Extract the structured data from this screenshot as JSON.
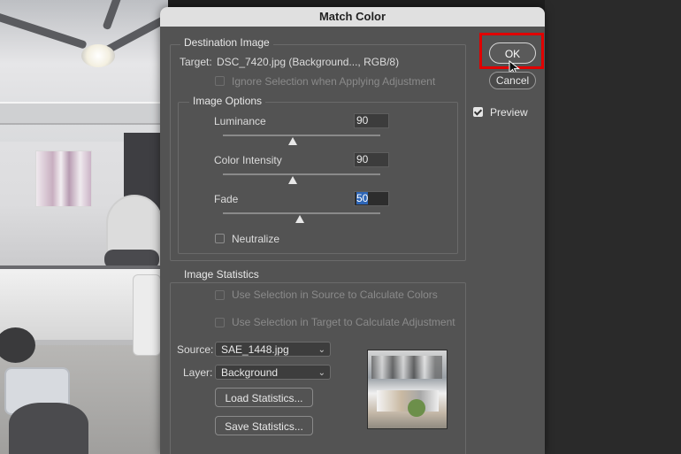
{
  "dialog": {
    "title": "Match Color",
    "ok_label": "OK",
    "cancel_label": "Cancel",
    "preview_label": "Preview",
    "preview_checked": true
  },
  "destination": {
    "group_title": "Destination Image",
    "target_label": "Target:",
    "target_value": "DSC_7420.jpg (Background..., RGB/8)",
    "ignore_selection_label": "Ignore Selection when Applying Adjustment"
  },
  "image_options": {
    "group_title": "Image Options",
    "luminance_label": "Luminance",
    "luminance_value": "90",
    "color_intensity_label": "Color Intensity",
    "color_intensity_value": "90",
    "fade_label": "Fade",
    "fade_value": "50",
    "neutralize_label": "Neutralize"
  },
  "statistics": {
    "group_title": "Image Statistics",
    "use_source_label": "Use Selection in Source to Calculate Colors",
    "use_target_label": "Use Selection in Target to Calculate Adjustment",
    "source_label": "Source:",
    "source_value": "SAE_1448.jpg",
    "layer_label": "Layer:",
    "layer_value": "Background",
    "load_label": "Load Statistics...",
    "save_label": "Save Statistics..."
  },
  "colors": {
    "dialog_bg": "#535353",
    "highlight": "#e00000",
    "selection": "#2d65b6"
  }
}
